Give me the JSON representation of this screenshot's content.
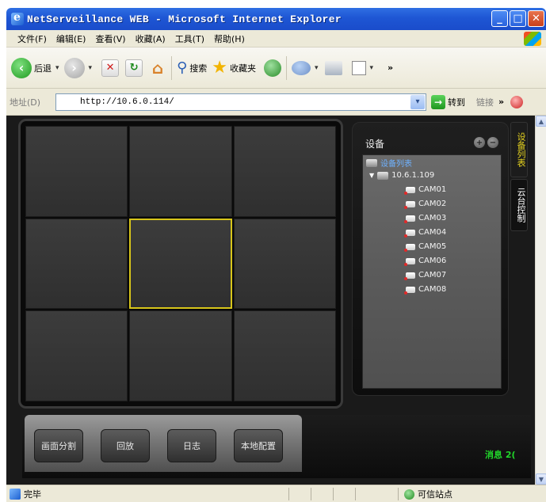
{
  "window": {
    "title": "NetServeillance WEB - Microsoft Internet Explorer",
    "minimize": "_",
    "maximize": "□",
    "close": "✕"
  },
  "menu": [
    "文件(F)",
    "编辑(E)",
    "查看(V)",
    "收藏(A)",
    "工具(T)",
    "帮助(H)"
  ],
  "toolbar": {
    "back_label": "后退",
    "search_label": "搜索",
    "favorites_label": "收藏夹",
    "dropdown_glyph": "▾",
    "more_glyph": "»"
  },
  "address": {
    "label": "地址(D)",
    "url": "http://10.6.0.114/",
    "go_label": "转到",
    "links_label": "链接",
    "links_chevron": "»"
  },
  "video_grid": {
    "rows": 3,
    "cols": 3,
    "selected_index": 4
  },
  "device_panel": {
    "title": "设备",
    "add_glyph": "+",
    "remove_glyph": "−",
    "root": "设备列表",
    "node": "10.6.1.109",
    "cameras": [
      "CAM01",
      "CAM02",
      "CAM03",
      "CAM04",
      "CAM05",
      "CAM06",
      "CAM07",
      "CAM08"
    ]
  },
  "side_tabs": [
    "设备列表",
    "云台控制"
  ],
  "bottom_buttons": [
    "画面分割",
    "回放",
    "日志",
    "本地配置"
  ],
  "message": {
    "label": "消息",
    "count": "2("
  },
  "status": {
    "text": "完毕",
    "zone": "可信站点"
  },
  "colors": {
    "xp_title_blue": "#1e56d4",
    "selected_cell_border": "#d7c51a",
    "active_tab_text": "#e6d320",
    "message_green": "#21d62a",
    "tree_root_blue": "#6fb2ff"
  }
}
